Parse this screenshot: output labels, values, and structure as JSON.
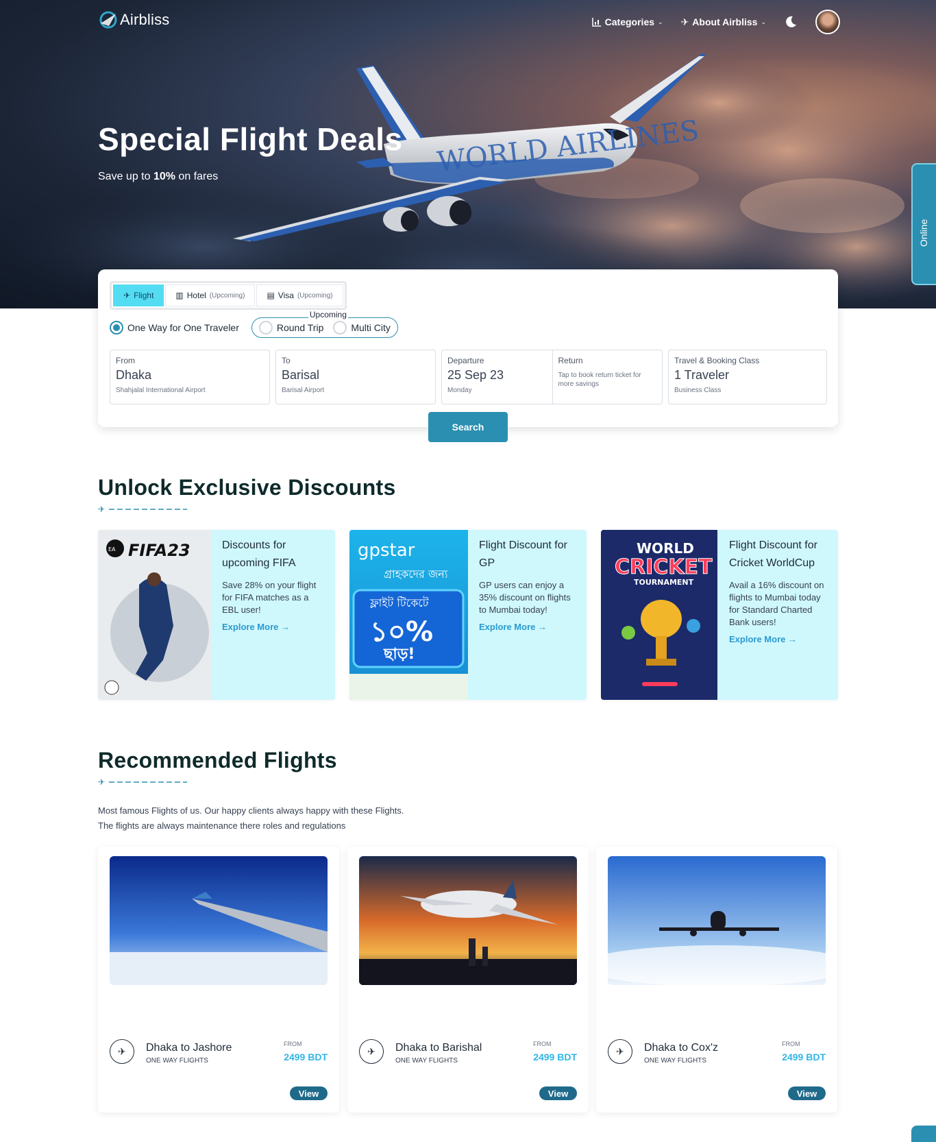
{
  "brand": {
    "name": "Airbliss"
  },
  "nav": {
    "categories": "Categories",
    "about": "About Airbliss"
  },
  "hero": {
    "title": "Special Flight Deals",
    "subtitle_prefix": "Save up to ",
    "subtitle_bold": "10%",
    "subtitle_suffix": " on fares",
    "plane_livery": "WORLD AIRLINES"
  },
  "online_tab": "Online",
  "search": {
    "tabs": [
      {
        "label": "Flight",
        "note": "",
        "icon": "plane-icon",
        "active": true
      },
      {
        "label": "Hotel",
        "note": "(Upcoming)",
        "icon": "hotel-icon",
        "active": false
      },
      {
        "label": "Visa",
        "note": "(Upcoming)",
        "icon": "visa-card-icon",
        "active": false
      }
    ],
    "trip_types": {
      "one_way": "One Way for One Traveler",
      "upcoming_label": "Upcoming",
      "round_trip": "Round Trip",
      "multi_city": "Multi City"
    },
    "from": {
      "label": "From",
      "value": "Dhaka",
      "hint": "Shahjalal International Airport"
    },
    "to": {
      "label": "To",
      "value": "Barisal",
      "hint": "Barisal Airport"
    },
    "departure": {
      "label": "Departure",
      "value": "25 Sep 23",
      "hint": "Monday"
    },
    "return": {
      "label": "Return",
      "hint": "Tap to book return ticket for more savings"
    },
    "travel": {
      "label": "Travel & Booking Class",
      "value": "1 Traveler",
      "hint": "Business Class"
    },
    "button": "Search"
  },
  "discounts": {
    "title": "Unlock Exclusive Discounts",
    "items": [
      {
        "title": "Discounts for upcoming FIFA",
        "desc": "Save 28% on your flight for FIFA matches as a EBL user!",
        "link": "Explore More →",
        "img_text": "FIFA23"
      },
      {
        "title": "Flight Discount for GP",
        "desc": "GP users can enjoy a 35% discount on flights to Mumbai today!",
        "link": "Explore More →",
        "img_text": "gpstar",
        "img_line1": "গ্রাহকদের জন্য",
        "img_line2": "ফ্লাইট টিকেটে",
        "img_line3": "১০%",
        "img_line4": "ছাড়!"
      },
      {
        "title": "Flight Discount for Cricket WorldCup",
        "desc": "Avail a 16% discount on flights to Mumbai today for Standard Charted Bank users!",
        "link": "Explore More →",
        "img_text1": "WORLD",
        "img_text2": "CRICKET",
        "img_text3": "TOURNAMENT"
      }
    ]
  },
  "recommended": {
    "title": "Recommended Flights",
    "desc_line1": "Most famous Flights of us. Our happy clients always happy with these Flights.",
    "desc_line2": "The flights are always maintenance there roles and regulations",
    "flights": [
      {
        "route": "Dhaka to Jashore",
        "kind": "ONE WAY FLIGHTS",
        "from_label": "FROM",
        "price": "2499 BDT",
        "button": "View"
      },
      {
        "route": "Dhaka to Barishal",
        "kind": "ONE WAY FLIGHTS",
        "from_label": "FROM",
        "price": "2499 BDT",
        "button": "View"
      },
      {
        "route": "Dhaka to Cox'z",
        "kind": "ONE WAY FLIGHTS",
        "from_label": "FROM",
        "price": "2499 BDT",
        "button": "View"
      }
    ]
  },
  "colors": {
    "accent": "#2a8fb0",
    "tab_active": "#54dcf2",
    "deal_bg": "#cff8fd",
    "price": "#2fb6e6",
    "view_button": "#1f6a8a"
  }
}
